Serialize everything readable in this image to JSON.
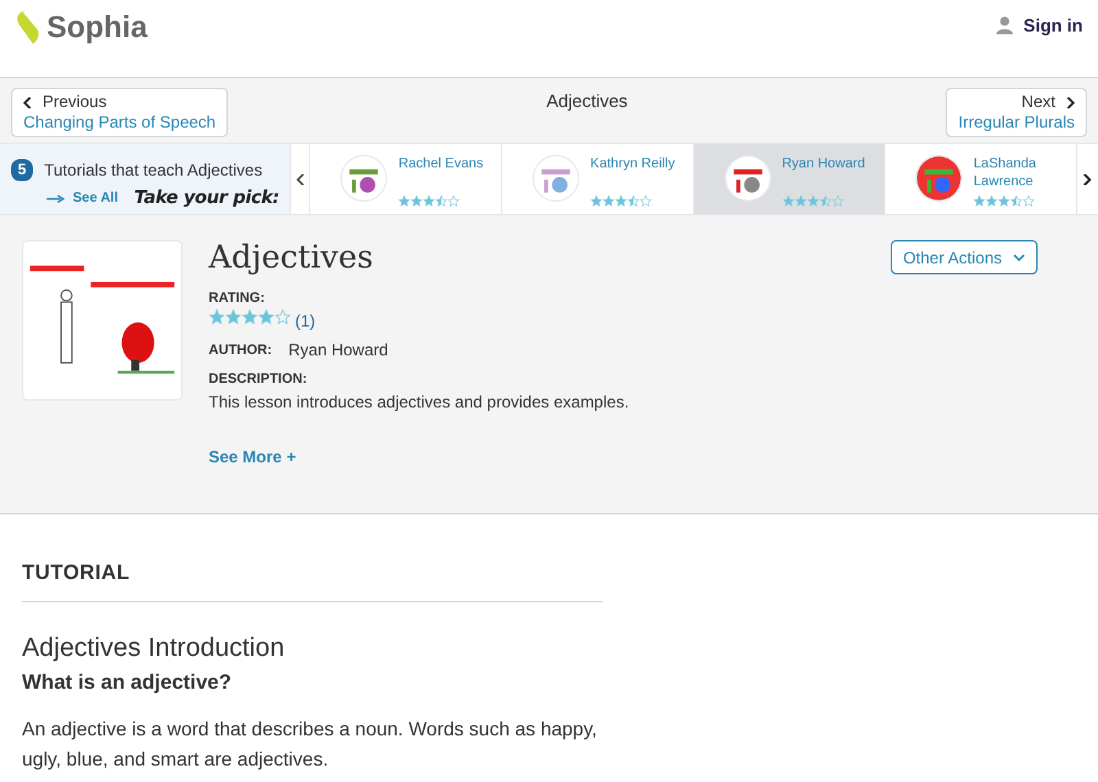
{
  "header": {
    "logo": "Sophia",
    "sign_in": "Sign in"
  },
  "nav": {
    "previous_label": "Previous",
    "previous_title": "Changing Parts of Speech",
    "title": "Adjectives",
    "next_label": "Next",
    "next_title": "Irregular Plurals"
  },
  "carousel": {
    "count": "5",
    "heading": "Tutorials that teach Adjectives",
    "see_all": "See All",
    "tagline": "Take your pick:",
    "items": [
      {
        "author": "Rachel Evans",
        "stars": 3.5,
        "selected": false
      },
      {
        "author": "Kathryn Reilly",
        "stars": 3.5,
        "selected": false
      },
      {
        "author": "Ryan Howard",
        "stars": 3.5,
        "selected": true
      },
      {
        "author": "LaShanda Lawrence",
        "stars": 3.5,
        "selected": false
      }
    ]
  },
  "lesson": {
    "title": "Adjectives",
    "rating_label": "RATING:",
    "stars": 4,
    "rating_count": "(1)",
    "author_label": "AUTHOR:",
    "author": "Ryan Howard",
    "description_label": "DESCRIPTION:",
    "description": "This lesson introduces adjectives and provides examples.",
    "see_more": "See More +",
    "other_actions": "Other Actions"
  },
  "tutorial": {
    "label": "TUTORIAL",
    "heading": "Adjectives Introduction",
    "subheading": "What is an adjective?",
    "body": "An adjective is a word that describes a noun.  Words such as happy, ugly, blue, and smart are adjectives."
  }
}
